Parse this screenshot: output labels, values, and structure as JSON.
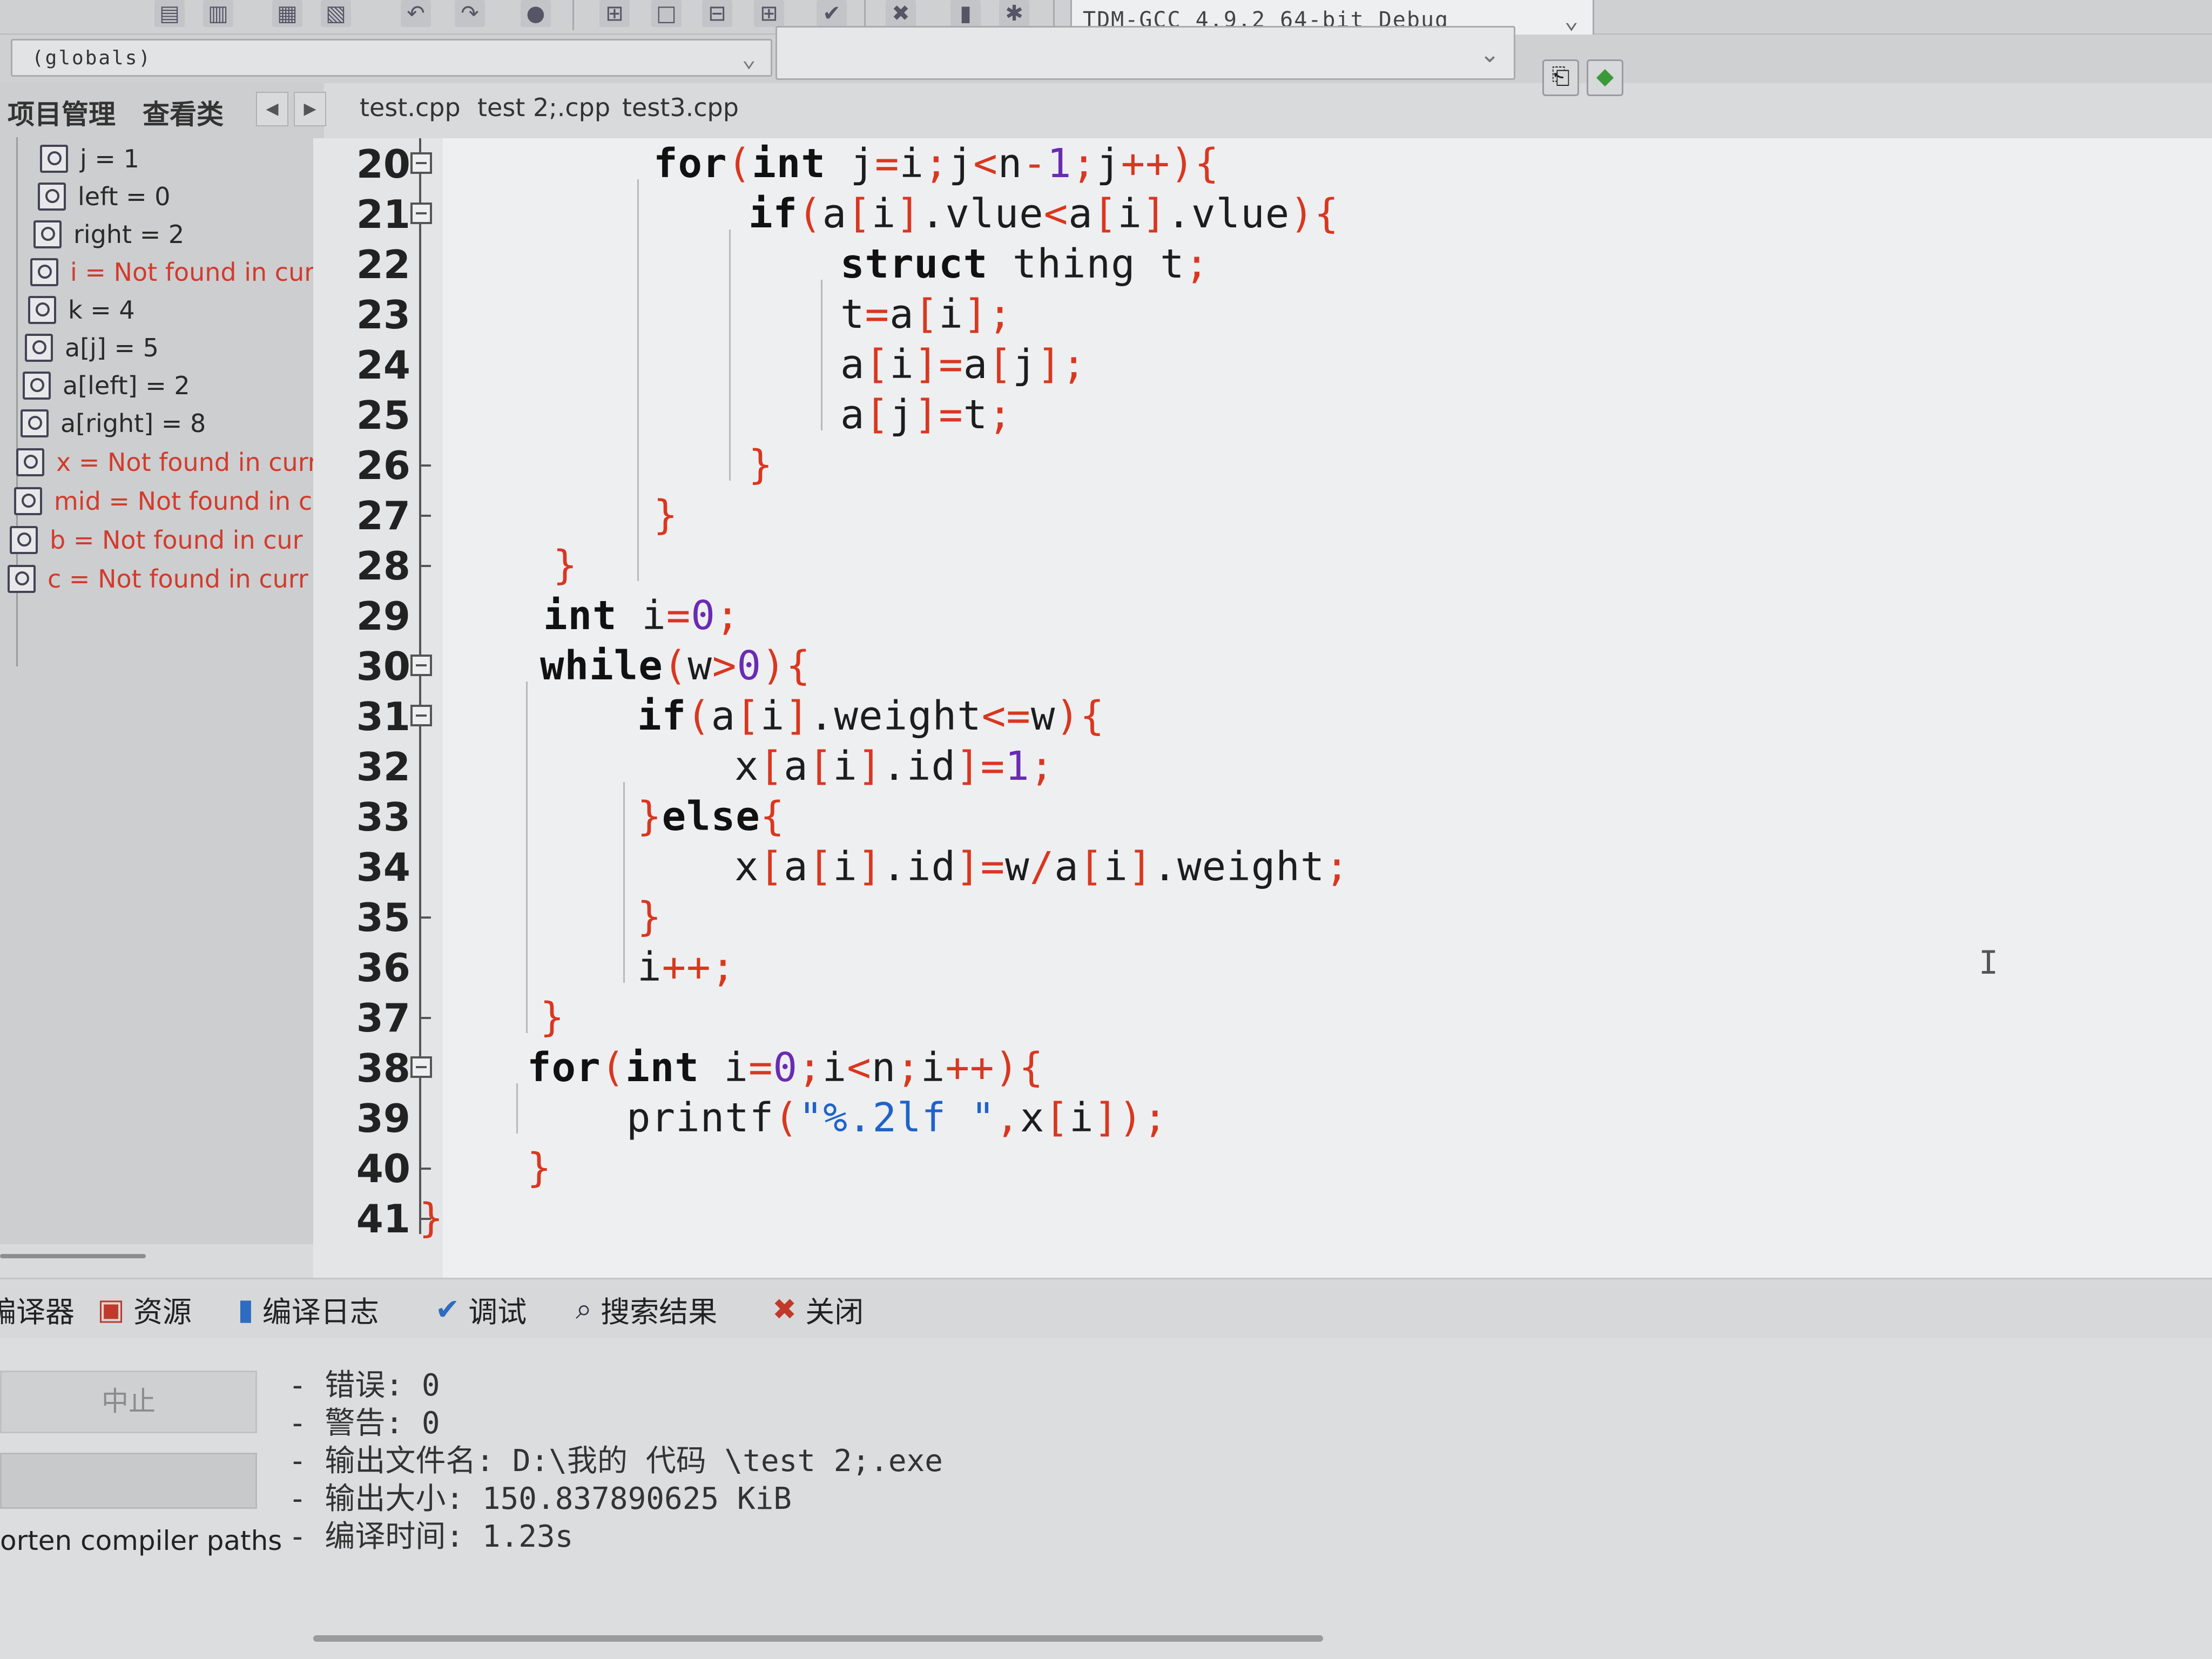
{
  "toolbar": {
    "compiler": "TDM-GCC 4.9.2 64-bit Debug"
  },
  "scope": {
    "value": "(globals)"
  },
  "left_panel": {
    "tabs": [
      "项目管理",
      "查看类"
    ],
    "watches": [
      {
        "text": "j = 1",
        "error": false
      },
      {
        "text": "left = 0",
        "error": false
      },
      {
        "text": "right = 2",
        "error": false
      },
      {
        "text": "i = Not found in curr",
        "error": true
      },
      {
        "text": "k = 4",
        "error": false
      },
      {
        "text": "a[j] = 5",
        "error": false
      },
      {
        "text": "a[left] = 2",
        "error": false
      },
      {
        "text": "a[right] = 8",
        "error": false
      },
      {
        "text": "x = Not found in curr",
        "error": true
      },
      {
        "text": "mid = Not found in c",
        "error": true
      },
      {
        "text": "b = Not found in cur",
        "error": true
      },
      {
        "text": "c = Not found in curr",
        "error": true
      }
    ]
  },
  "file_tabs": [
    "test.cpp",
    "test 2;.cpp",
    "test3.cpp"
  ],
  "editor": {
    "line_numbers": [
      "20",
      "21",
      "22",
      "23",
      "24",
      "25",
      "26",
      "27",
      "28",
      "29",
      "30",
      "31",
      "32",
      "33",
      "34",
      "35",
      "36",
      "37",
      "38",
      "39",
      "40",
      "41"
    ]
  },
  "bottom": {
    "tabs": [
      {
        "label": "编译器",
        "icon": "compiler-icon"
      },
      {
        "label": "资源",
        "icon": "resource-icon"
      },
      {
        "label": "编译日志",
        "icon": "compile-log-icon"
      },
      {
        "label": "调试",
        "icon": "debug-check-icon"
      },
      {
        "label": "搜索结果",
        "icon": "search-results-icon"
      },
      {
        "label": "关闭",
        "icon": "close-icon"
      }
    ],
    "abort_label": "中止",
    "shorten_label": "orten compiler paths",
    "log": [
      "- 错误: 0",
      "- 警告: 0",
      "- 输出文件名: D:\\我的 代码 \\test 2;.exe",
      "- 输出大小: 150.837890625 KiB",
      "- 编译时间: 1.23s"
    ]
  }
}
